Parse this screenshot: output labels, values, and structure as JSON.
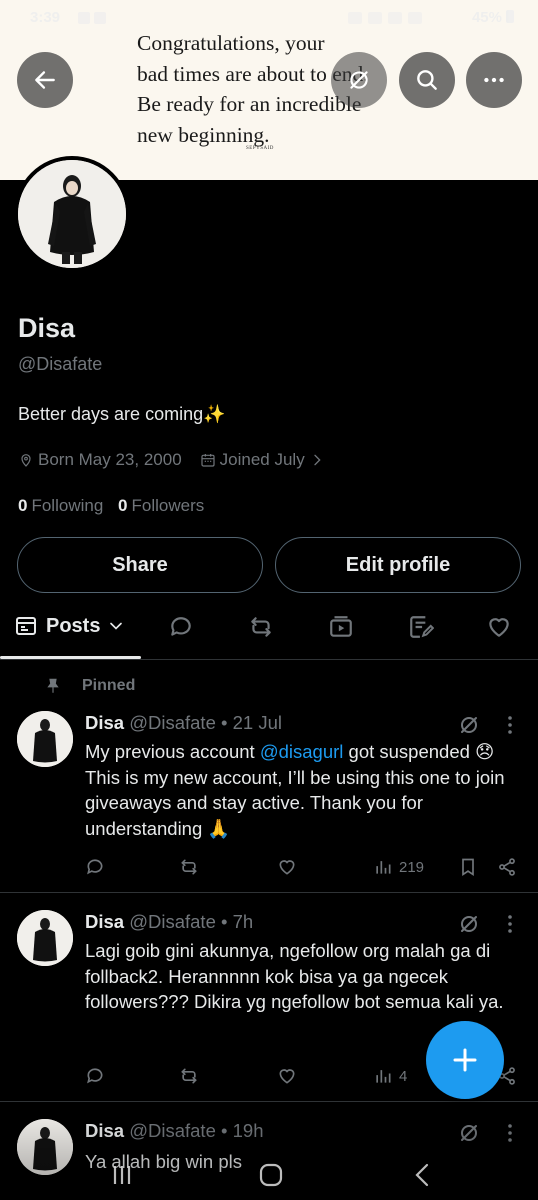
{
  "status_bar": {
    "time": "3:39",
    "battery": "45%"
  },
  "banner": {
    "quote": "Congratulations, your\nbad times are about to end.\nBe ready for an incredible\nnew beginning.",
    "signature": "SEPYSAID"
  },
  "profile": {
    "name": "Disa",
    "handle": "@Disafate",
    "bio": "Better days are coming✨",
    "born": "Born May 23, 2000",
    "joined": "Joined July",
    "following_count": "0",
    "following_label": "Following",
    "followers_count": "0",
    "followers_label": "Followers"
  },
  "buttons": {
    "share": "Share",
    "edit_profile": "Edit profile"
  },
  "tabs": {
    "posts": "Posts"
  },
  "pinned_label": "Pinned",
  "posts": [
    {
      "name": "Disa",
      "handle": "@Disafate",
      "time": "21 Jul",
      "text_before": "My previous account ",
      "mention": "@disagurl",
      "text_after": " got suspended 😞 This is my new account, I’ll be using this one to join giveaways and stay active. Thank you for understanding 🙏",
      "views": "219"
    },
    {
      "name": "Disa",
      "handle": "@Disafate",
      "time": "7h",
      "text": "Lagi goib gini akunnya, ngefollow org malah ga di follback2. Herannnnn kok bisa ya ga ngecek followers??? Dikira yg ngefollow bot semua kali ya.",
      "views": "4"
    },
    {
      "name": "Disa",
      "handle": "@Disafate",
      "time": "19h",
      "text": "Ya allah big win pls"
    }
  ],
  "colors": {
    "accent": "#1d9bf0",
    "background": "#000000",
    "banner": "#fbf7ef",
    "muted": "#71767b"
  }
}
